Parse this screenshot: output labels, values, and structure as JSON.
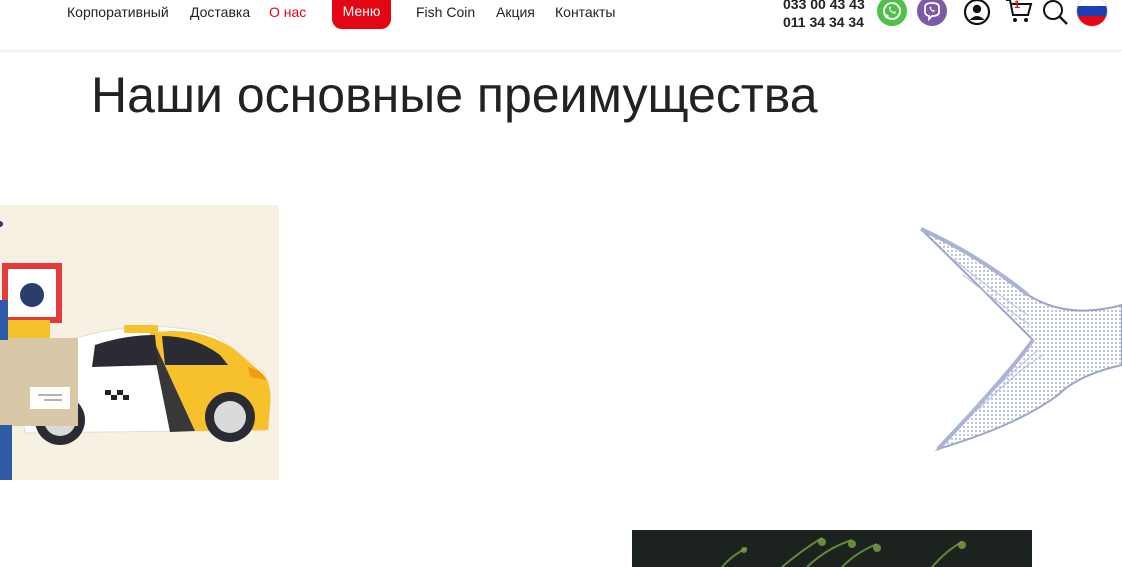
{
  "header": {
    "nav": [
      {
        "label": "Корпоративный",
        "active": false
      },
      {
        "label": "Доставка",
        "active": false
      },
      {
        "label": "О нас",
        "active": true
      },
      {
        "label": "Меню",
        "active": false,
        "highlight": true
      },
      {
        "label": "Fish Coin",
        "active": false
      },
      {
        "label": "Акция",
        "active": false
      },
      {
        "label": "Контакты",
        "active": false
      }
    ],
    "phones": [
      "033 00 43 43",
      "011 34 34 34"
    ],
    "cart_count": "1",
    "accent_color": "#e30613",
    "icons": [
      "whatsapp-icon",
      "viber-icon",
      "user-icon",
      "cart-icon",
      "search-icon",
      "language-flag-icon"
    ]
  },
  "main": {
    "title": "Наши основные преимущества"
  }
}
